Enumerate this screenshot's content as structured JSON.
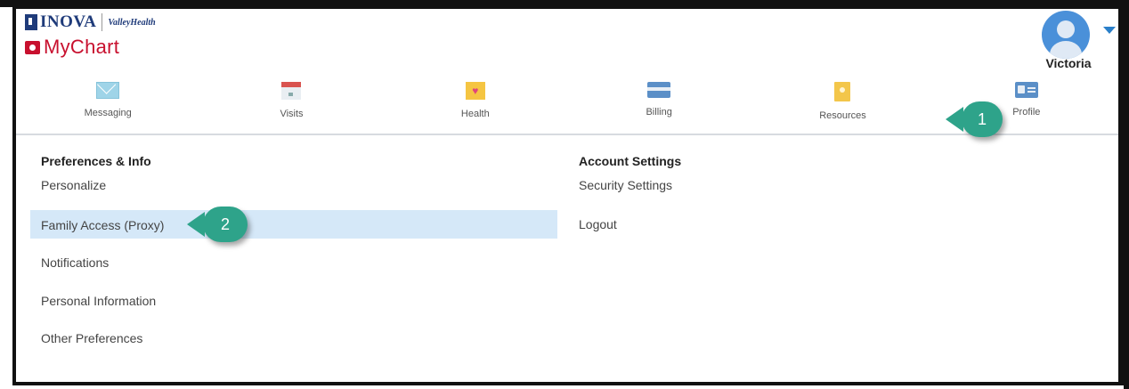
{
  "brand": {
    "inova": "INOVA",
    "valley_health": "ValleyHealth",
    "mychart": "MyChart"
  },
  "user": {
    "name": "Victoria"
  },
  "nav": [
    {
      "label": "Messaging",
      "icon": "envelope-icon"
    },
    {
      "label": "Visits",
      "icon": "calendar-icon"
    },
    {
      "label": "Health",
      "icon": "heart-icon"
    },
    {
      "label": "Billing",
      "icon": "credit-card-icon"
    },
    {
      "label": "Resources",
      "icon": "book-icon"
    },
    {
      "label": "Profile",
      "icon": "id-card-icon"
    }
  ],
  "menu": {
    "left_title": "Preferences & Info",
    "left_items": [
      "Personalize",
      "Family Access (Proxy)",
      "Notifications",
      "Personal Information",
      "Other Preferences"
    ],
    "right_title": "Account Settings",
    "right_items": [
      "Security Settings",
      "Logout"
    ]
  },
  "callouts": [
    "1",
    "2"
  ],
  "colors": {
    "accent_blue": "#2a7fc9",
    "highlight": "#d5e8f8",
    "callout": "#2ea38a",
    "mychart_red": "#c8102e"
  }
}
